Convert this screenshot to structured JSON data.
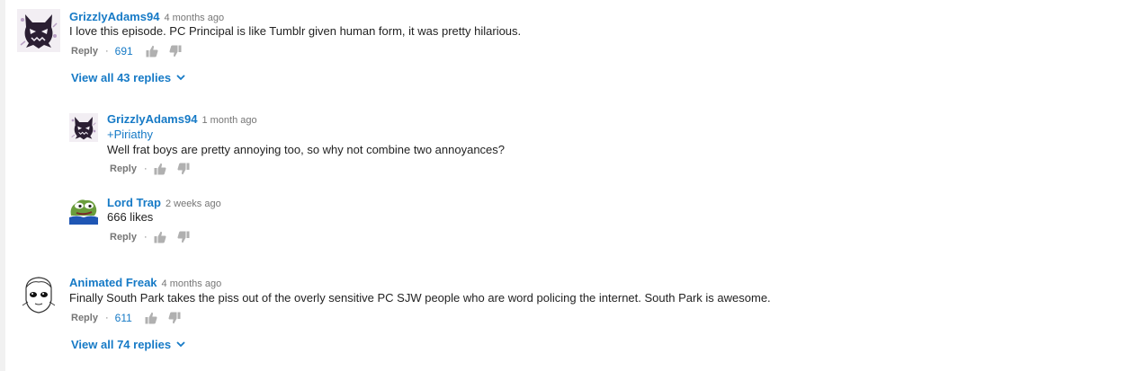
{
  "colors": {
    "link": "#167ac6",
    "meta": "#767676",
    "text": "#222222",
    "page_bg": "#f1f1f1"
  },
  "comments": [
    {
      "author": "GrizzlyAdams94",
      "time": "4 months ago",
      "text": "I love this episode. PC Principal is like Tumblr given human form, it was pretty hilarious.",
      "reply_label": "Reply",
      "likes": "691",
      "view_all": "View all 43 replies",
      "avatar_icon": "ghost-cat-icon"
    },
    {
      "author": "GrizzlyAdams94",
      "time": "1 month ago",
      "mention": "+Piriathy",
      "text": "Well frat boys are pretty annoying too, so why not combine two annoyances?",
      "reply_label": "Reply",
      "avatar_icon": "ghost-cat-icon"
    },
    {
      "author": "Lord Trap",
      "time": "2 weeks ago",
      "text": "666 likes",
      "reply_label": "Reply",
      "avatar_icon": "frog-icon"
    },
    {
      "author": "Animated Freak",
      "time": "4 months ago",
      "text": "Finally South Park takes the piss out of the overly sensitive PC SJW people who are word policing the internet. South Park is awesome.",
      "reply_label": "Reply",
      "likes": "611",
      "view_all": "View all 74 replies",
      "avatar_icon": "sketch-face-icon"
    }
  ]
}
